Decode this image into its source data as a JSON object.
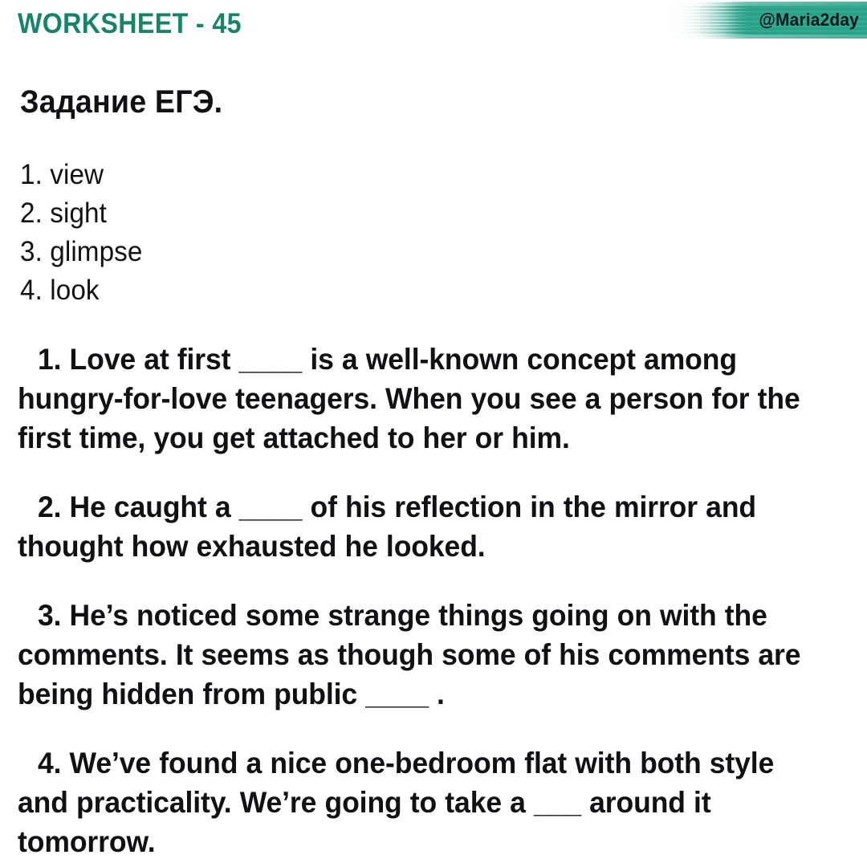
{
  "header": {
    "worksheet_label": "WORKSHEET - 45",
    "handle": "@Maria2day",
    "accent_color": "#17836a",
    "brush_color": "#2aa58c"
  },
  "task": {
    "title": "Задание ЕГЭ."
  },
  "options": [
    {
      "label": "1. view"
    },
    {
      "label": "2. sight"
    },
    {
      "label": "3. glimpse"
    },
    {
      "label": "4. look"
    }
  ],
  "questions": [
    {
      "text": "1. Love at first ____ is a well-known concept among hungry-for-love teenagers. When you see a person for the first time, you get attached to her or him."
    },
    {
      "text": "2. He caught a ____ of his reflection in the mirror and thought how exhausted he looked."
    },
    {
      "text": "3.  He’s noticed some strange things going on with the comments. It seems as though some of his comments are being hidden from public ____ ."
    },
    {
      "text": "4. We’ve found a nice one-bedroom flat with both style and practicality. We’re going to take a ___ around it tomorrow."
    }
  ]
}
